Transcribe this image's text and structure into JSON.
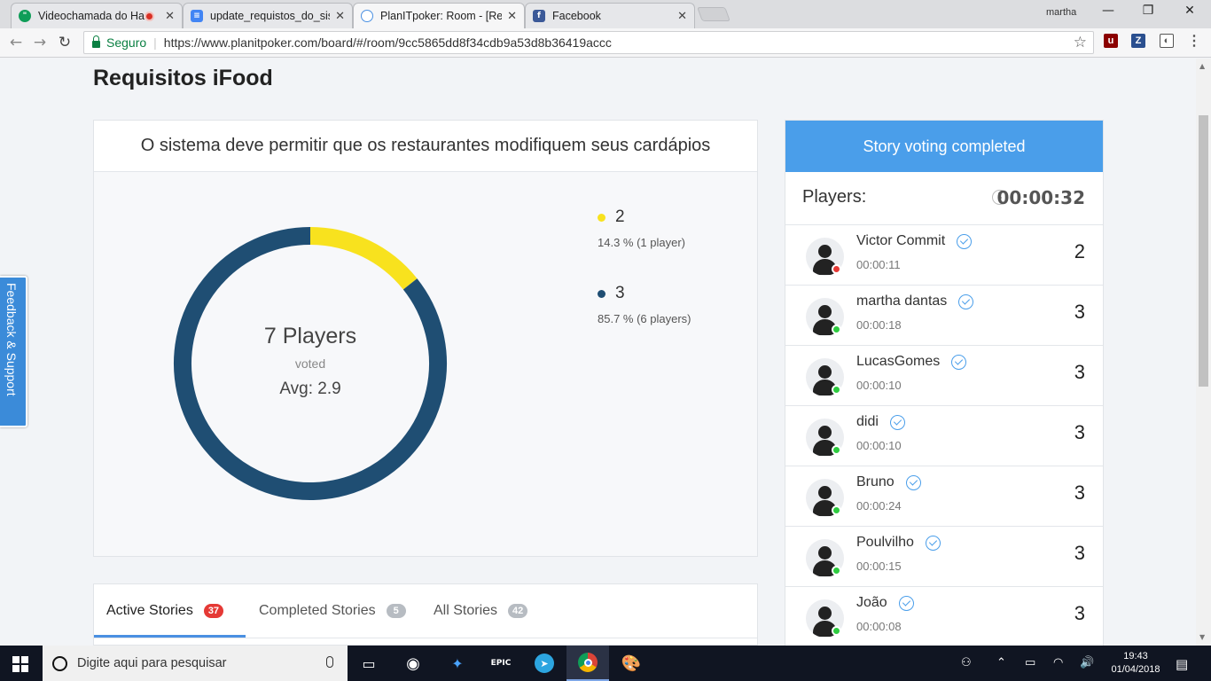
{
  "browser": {
    "tabs": [
      {
        "title": "Videochamada do Ha",
        "favicon_color": "#0f9d58"
      },
      {
        "title": "update_requistos_do_sist",
        "favicon_color": "#4285f4"
      },
      {
        "title": "PlanITpoker: Room - [Re",
        "favicon_color": "#ffffff"
      },
      {
        "title": "Facebook",
        "favicon_color": "#3b5998"
      }
    ],
    "close_glyph": "✕",
    "user": "martha",
    "security_label": "Seguro",
    "url": "https://www.planitpoker.com/board/#/room/9cc5865dd8f34cdb9a53d8b36419accc"
  },
  "page": {
    "title": "Requisitos iFood",
    "story_title": "O sistema deve permitir que os restaurantes modifiquem seus cardápios"
  },
  "chart_data": {
    "type": "pie",
    "categories": [
      "2",
      "3"
    ],
    "values": [
      14.3,
      85.7
    ],
    "players": [
      1,
      6
    ],
    "colors": [
      "#f8e21e",
      "#1f4e73"
    ],
    "legend": [
      {
        "label": "2",
        "detail": "14.3 % (1 player)"
      },
      {
        "label": "3",
        "detail": "85.7 % (6 players)"
      }
    ],
    "center": {
      "count": "7 Players",
      "sub": "voted",
      "avg": "Avg: 2.9"
    }
  },
  "stories_tabs": [
    {
      "label": "Active Stories",
      "count": "37",
      "badge_color": "#e53935"
    },
    {
      "label": "Completed Stories",
      "count": "5",
      "badge_color": "#b7bcc2"
    },
    {
      "label": "All Stories",
      "count": "42",
      "badge_color": "#b7bcc2"
    }
  ],
  "voting": {
    "status": "Story voting completed",
    "players_label": "Players:",
    "timer": "00:00:32",
    "players": [
      {
        "name": "Victor Commit",
        "time": "00:00:11",
        "vote": "2",
        "status_color": "#e53935"
      },
      {
        "name": "martha dantas",
        "time": "00:00:18",
        "vote": "3",
        "status_color": "#2ecc40"
      },
      {
        "name": "LucasGomes",
        "time": "00:00:10",
        "vote": "3",
        "status_color": "#2ecc40"
      },
      {
        "name": "didi",
        "time": "00:00:10",
        "vote": "3",
        "status_color": "#2ecc40"
      },
      {
        "name": "Bruno",
        "time": "00:00:24",
        "vote": "3",
        "status_color": "#2ecc40"
      },
      {
        "name": "Poulvilho",
        "time": "00:00:15",
        "vote": "3",
        "status_color": "#2ecc40"
      },
      {
        "name": "João",
        "time": "00:00:08",
        "vote": "3",
        "status_color": "#2ecc40"
      }
    ]
  },
  "feedback_label": "Feedback & Support",
  "taskbar": {
    "search_placeholder": "Digite aqui para pesquisar",
    "time": "19:43",
    "date": "01/04/2018"
  }
}
